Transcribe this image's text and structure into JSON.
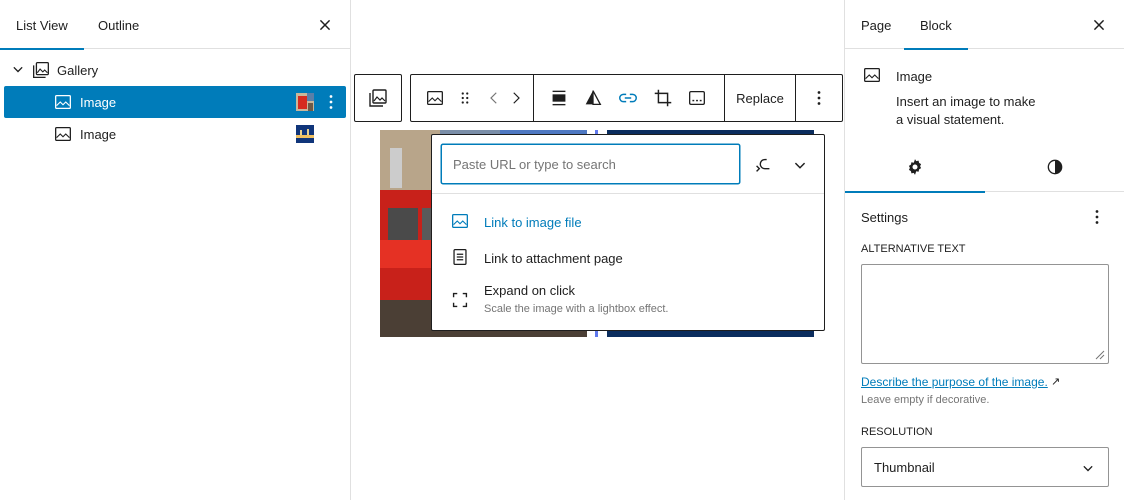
{
  "list_view": {
    "tabs": [
      {
        "label": "List View"
      },
      {
        "label": "Outline"
      }
    ],
    "tree": [
      {
        "label": "Gallery"
      },
      {
        "label": "Image"
      },
      {
        "label": "Image"
      }
    ]
  },
  "toolbar": {
    "replace_label": "Replace"
  },
  "link_popover": {
    "search_placeholder": "Paste URL or type to search",
    "items": [
      {
        "label": "Link to image file"
      },
      {
        "label": "Link to attachment page"
      },
      {
        "label": "Expand on click",
        "description": "Scale the image with a lightbox effect."
      }
    ]
  },
  "inspector": {
    "tabs": [
      {
        "label": "Page"
      },
      {
        "label": "Block"
      }
    ],
    "block": {
      "title": "Image",
      "description_line1": "Insert an image to make",
      "description_line2": "a visual statement."
    },
    "settings_title": "Settings",
    "alt_text_label": "ALTERNATIVE TEXT",
    "alt_text_value": "",
    "help_link": "Describe the purpose of the image.",
    "help_link_arrow": "↗",
    "help_note": "Leave empty if decorative.",
    "resolution_label": "RESOLUTION",
    "resolution_value": "Thumbnail"
  },
  "colors": {
    "accent": "#007cba",
    "selection": "#007cba",
    "border": "#e0e0e0"
  }
}
